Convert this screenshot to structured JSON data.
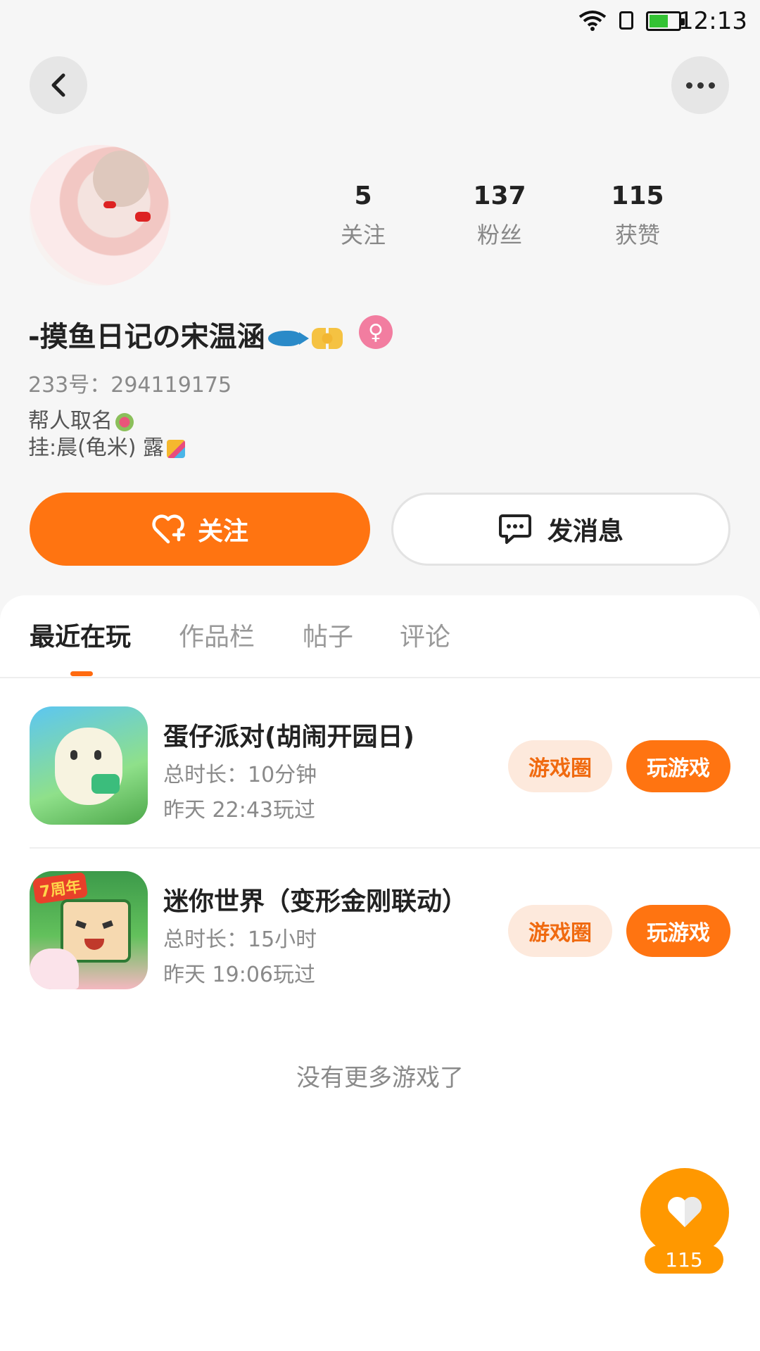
{
  "status_bar": {
    "time": "12:13"
  },
  "profile": {
    "stats": [
      {
        "value": "5",
        "label": "关注"
      },
      {
        "value": "137",
        "label": "粉丝"
      },
      {
        "value": "115",
        "label": "获赞"
      }
    ],
    "nickname": "-摸鱼日记の宋温涵",
    "gender_symbol": "♀",
    "uid": "233号：294119175",
    "bio_line1": "帮人取名",
    "bio_line2": "挂:晨(龟米) 露"
  },
  "actions": {
    "follow_label": "关注",
    "message_label": "发消息"
  },
  "tabs": [
    {
      "label": "最近在玩",
      "active": true
    },
    {
      "label": "作品栏",
      "active": false
    },
    {
      "label": "帖子",
      "active": false
    },
    {
      "label": "评论",
      "active": false
    }
  ],
  "games": [
    {
      "name": "蛋仔派对(胡闹开园日)",
      "duration": "总时长：10分钟",
      "last_played": "昨天 22:43玩过",
      "circle_label": "游戏圈",
      "play_label": "玩游戏"
    },
    {
      "name": "迷你世界（变形金刚联动）",
      "duration": "总时长：15小时",
      "last_played": "昨天 19:06玩过",
      "circle_label": "游戏圈",
      "play_label": "玩游戏",
      "icon_badge": "7周年"
    }
  ],
  "footer": {
    "no_more_text": "没有更多游戏了"
  },
  "like_fab": {
    "count": "115"
  },
  "colors": {
    "accent": "#ff7411",
    "accent_light": "#fde9dc",
    "fab": "#ff9800",
    "gender": "#f27da0"
  },
  "icons": [
    "wifi-icon",
    "sim-icon",
    "battery-icon",
    "back-arrow-icon",
    "more-dots-icon",
    "heart-plus-icon",
    "chat-bubble-icon",
    "heart-icon"
  ]
}
